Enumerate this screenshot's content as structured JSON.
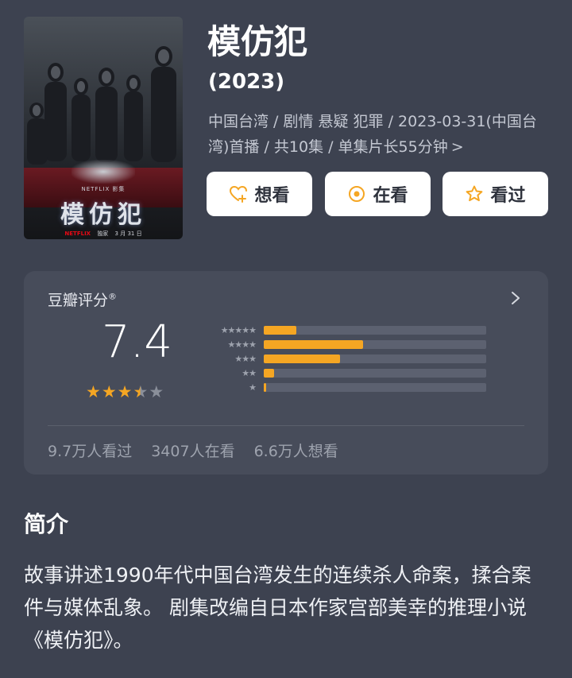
{
  "poster": {
    "brand_text": "NETFLIX 影集",
    "title_text": "模仿犯",
    "footer_brand": "NETFLIX",
    "footer_exclusive": "独家",
    "footer_date": "3 月 31 日"
  },
  "title": "模仿犯",
  "year": "(2023)",
  "meta": {
    "text": "中国台湾 / 剧情 悬疑 犯罪 / 2023-03-31(中国台湾)首播 / 共10集 / 单集片长55分钟",
    "chevron": ">"
  },
  "actions": [
    {
      "label": "想看",
      "icon": "heart-plus-icon"
    },
    {
      "label": "在看",
      "icon": "target-icon"
    },
    {
      "label": "看过",
      "icon": "star-outline-icon"
    }
  ],
  "rating": {
    "label": "豆瓣评分",
    "registered": "®",
    "score": "7.4",
    "star_value": 3.5,
    "star_color": "#f5a623",
    "distribution": [
      {
        "stars": "★★★★★",
        "percent": 14.6
      },
      {
        "stars": "★★★★",
        "percent": 44.8
      },
      {
        "stars": "★★★",
        "percent": 34.2
      },
      {
        "stars": "★★",
        "percent": 4.5
      },
      {
        "stars": "★",
        "percent": 1.0
      }
    ],
    "stats": [
      "9.7万人看过",
      "3407人在看",
      "6.6万人想看"
    ]
  },
  "synopsis": {
    "heading": "简介",
    "text": "故事讲述1990年代中国台湾发生的连续杀人命案，揉合案件与媒体乱象。 剧集改编自日本作家宫部美幸的推理小说《模仿犯》。"
  },
  "colors": {
    "background": "#3d4250",
    "card": "#474c5a",
    "accent": "#f5a623"
  }
}
